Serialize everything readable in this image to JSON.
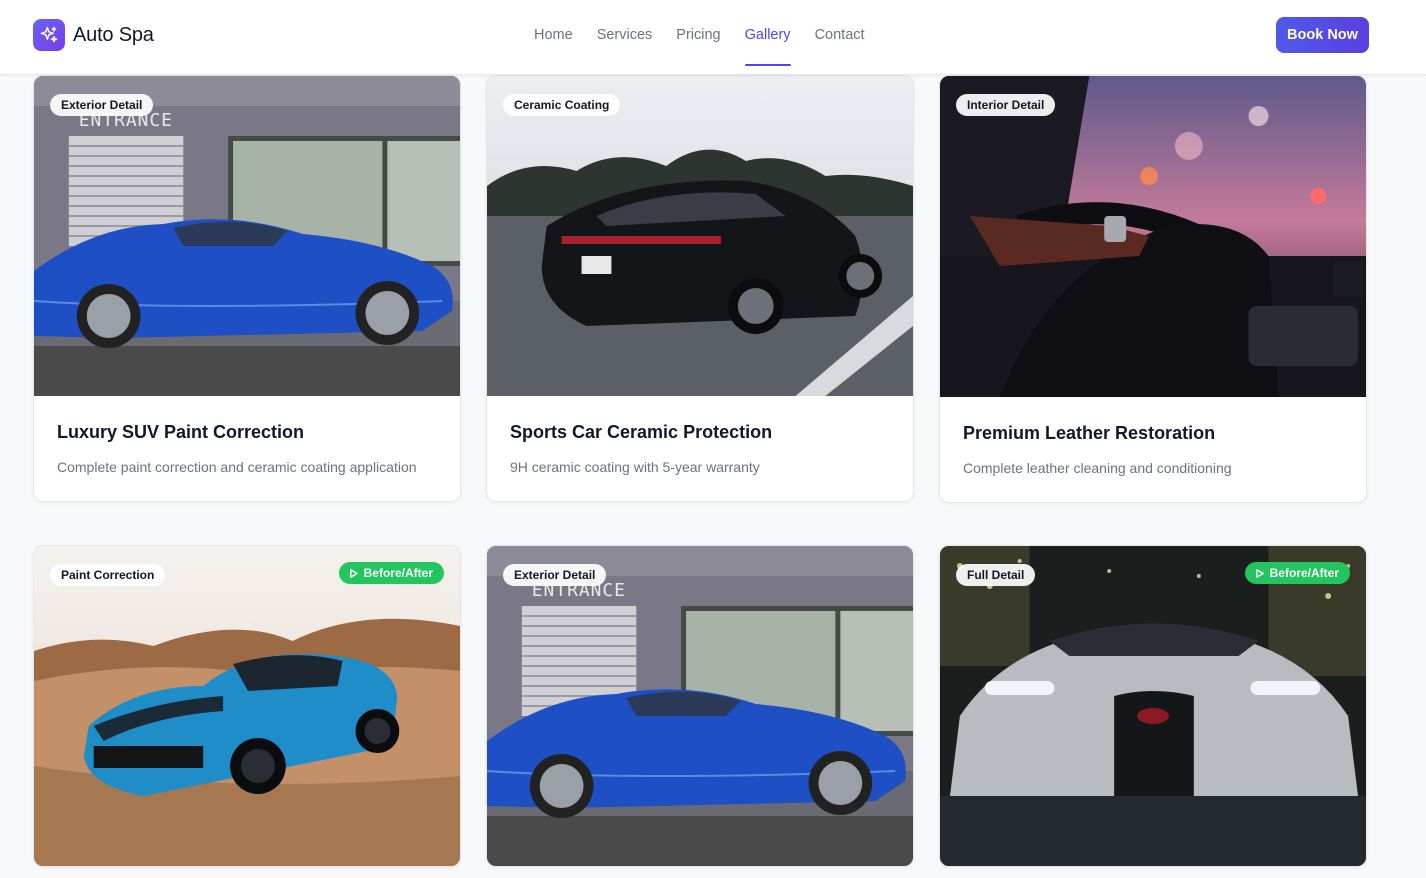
{
  "brand": {
    "name": "Auto Spa",
    "icon": "sparkles-icon",
    "accent": "#4f46e5"
  },
  "nav": {
    "items": [
      {
        "label": "Home",
        "active": false
      },
      {
        "label": "Services",
        "active": false
      },
      {
        "label": "Pricing",
        "active": false
      },
      {
        "label": "Gallery",
        "active": true
      },
      {
        "label": "Contact",
        "active": false
      }
    ],
    "cta_label": "Book Now"
  },
  "gallery": {
    "items": [
      {
        "category": "Exterior Detail",
        "title": "Luxury SUV Paint Correction",
        "description": "Complete paint correction and ceramic coating application",
        "before_after": false
      },
      {
        "category": "Ceramic Coating",
        "title": "Sports Car Ceramic Protection",
        "description": "9H ceramic coating with 5-year warranty",
        "before_after": false
      },
      {
        "category": "Interior Detail",
        "title": "Premium Leather Restoration",
        "description": "Complete leather cleaning and conditioning",
        "before_after": false
      },
      {
        "category": "Paint Correction",
        "title": "",
        "description": "",
        "before_after": true,
        "before_after_label": "Before/After"
      },
      {
        "category": "Exterior Detail",
        "title": "",
        "description": "",
        "before_after": false
      },
      {
        "category": "Full Detail",
        "title": "",
        "description": "",
        "before_after": true,
        "before_after_label": "Before/After"
      }
    ]
  },
  "colors": {
    "before_after_badge": "#22c55e",
    "cta_gradient_start": "#4f5ae8",
    "cta_gradient_end": "#5b3fe0"
  }
}
